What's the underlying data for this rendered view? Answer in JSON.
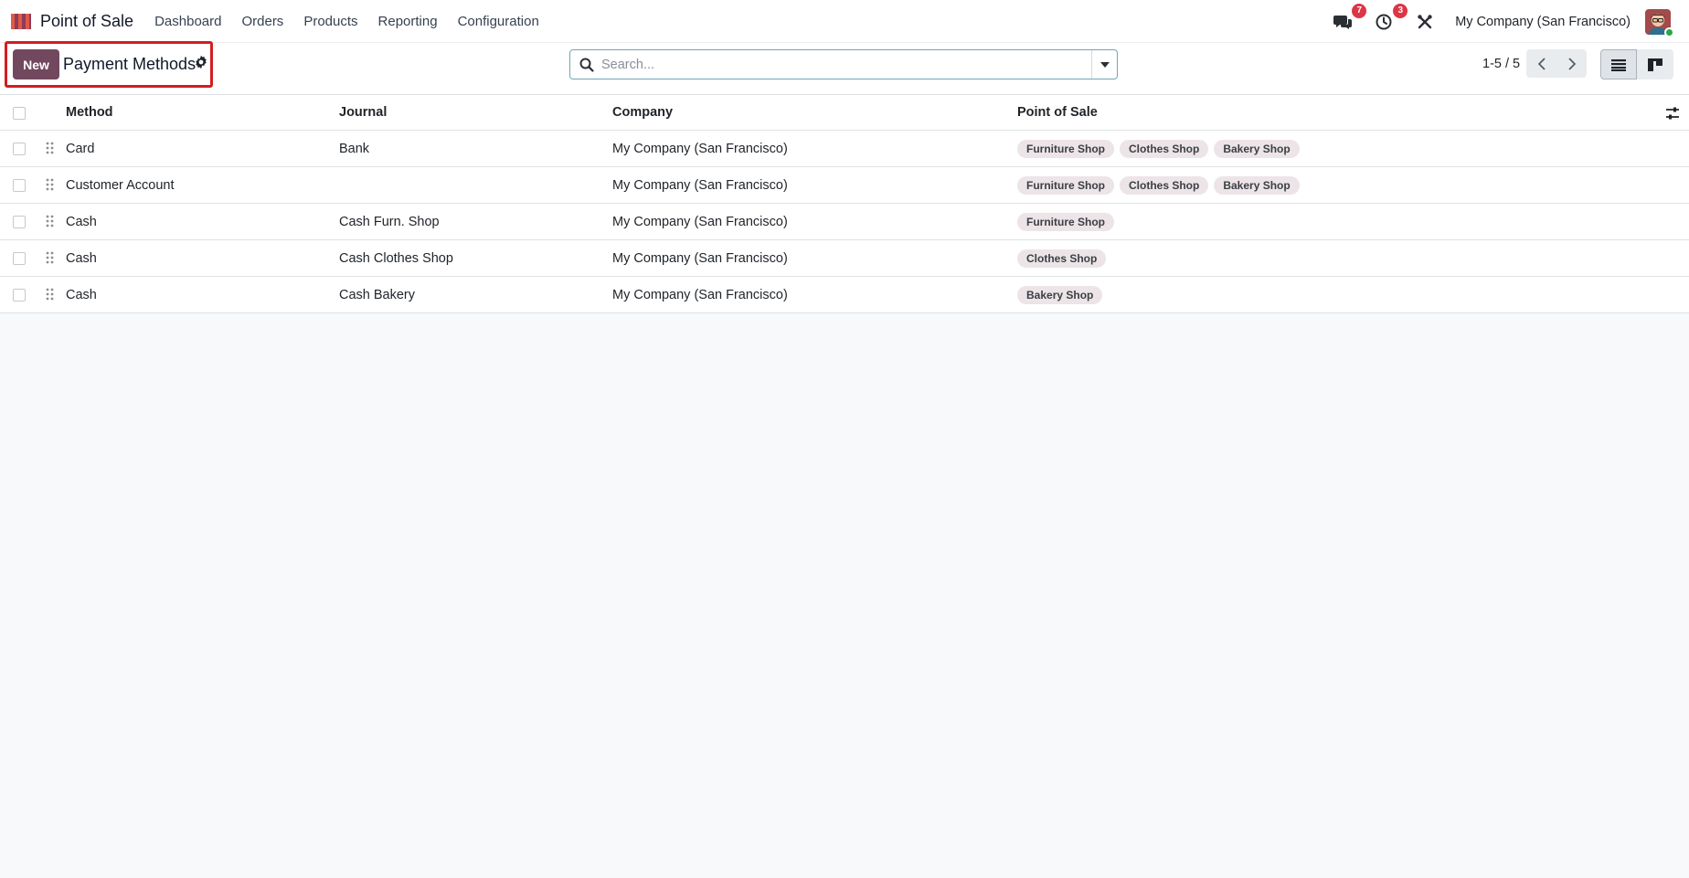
{
  "navbar": {
    "app_name": "Point of Sale",
    "menu": [
      "Dashboard",
      "Orders",
      "Products",
      "Reporting",
      "Configuration"
    ],
    "messages_count": "7",
    "activities_count": "3",
    "company": "My Company (San Francisco)"
  },
  "control_panel": {
    "new_label": "New",
    "title": "Payment Methods",
    "search_placeholder": "Search...",
    "pager": "1-5 / 5"
  },
  "table": {
    "columns": {
      "method": "Method",
      "journal": "Journal",
      "company": "Company",
      "pos": "Point of Sale"
    },
    "rows": [
      {
        "method": "Card",
        "journal": "Bank",
        "company": "My Company (San Francisco)",
        "pos": [
          "Furniture Shop",
          "Clothes Shop",
          "Bakery Shop"
        ]
      },
      {
        "method": "Customer Account",
        "journal": "",
        "company": "My Company (San Francisco)",
        "pos": [
          "Furniture Shop",
          "Clothes Shop",
          "Bakery Shop"
        ]
      },
      {
        "method": "Cash",
        "journal": "Cash Furn. Shop",
        "company": "My Company (San Francisco)",
        "pos": [
          "Furniture Shop"
        ]
      },
      {
        "method": "Cash",
        "journal": "Cash Clothes Shop",
        "company": "My Company (San Francisco)",
        "pos": [
          "Clothes Shop"
        ]
      },
      {
        "method": "Cash",
        "journal": "Cash Bakery",
        "company": "My Company (San Francisco)",
        "pos": [
          "Bakery Shop"
        ]
      }
    ]
  },
  "colors": {
    "primary": "#71485e",
    "highlight": "#d11f1f",
    "badge": "#dc3545",
    "tag_bg": "#ece4e6"
  },
  "icons": {
    "app_logo": "pos-awning-icon",
    "messages": "chat-bubbles-icon",
    "activities": "clock-icon",
    "tools": "tools-cross-icon",
    "settings": "gear-icon",
    "search": "search-icon",
    "dropdown": "caret-down-icon",
    "list_view": "list-view-icon",
    "kanban_view": "kanban-view-icon",
    "column_settings": "sliders-icon"
  }
}
